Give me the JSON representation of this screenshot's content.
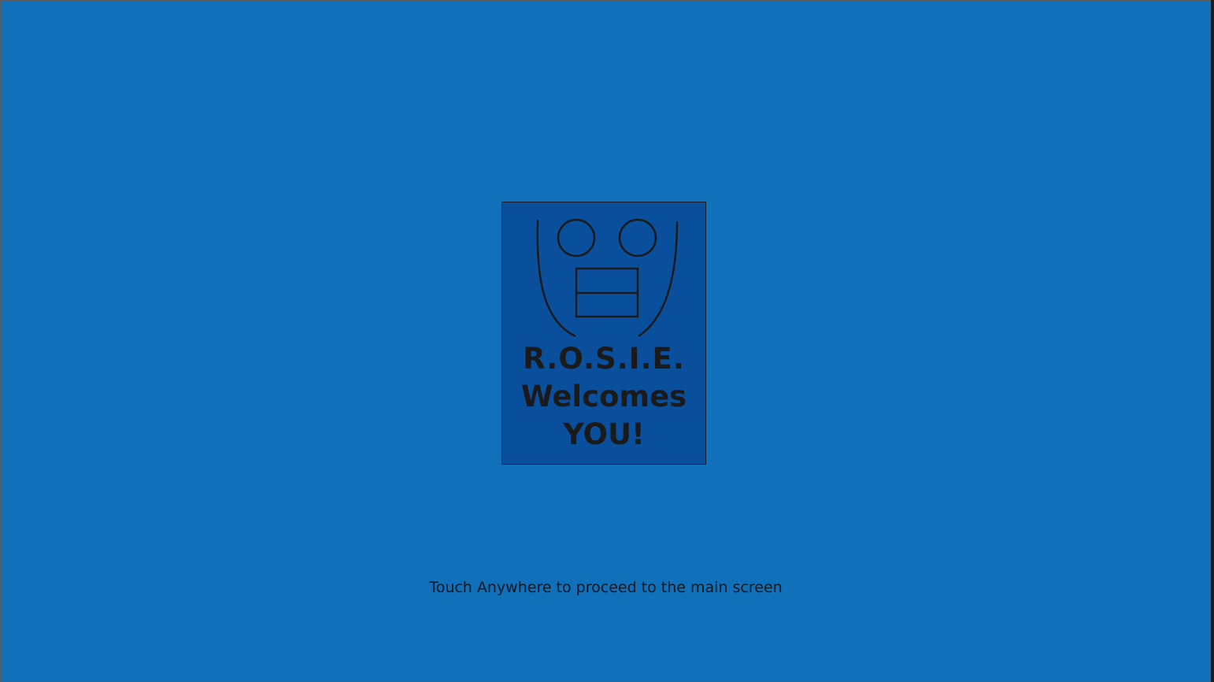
{
  "welcome": {
    "line1": "R.O.S.I.E.",
    "line2": "Welcomes",
    "line3": "YOU!"
  },
  "hint": {
    "text": "Touch Anywhere to proceed to the main screen"
  },
  "colors": {
    "background": "#1070ba",
    "card": "#0a4f9c",
    "text": "#1a1a1a"
  },
  "icons": {
    "logo": "robot-face-icon"
  }
}
